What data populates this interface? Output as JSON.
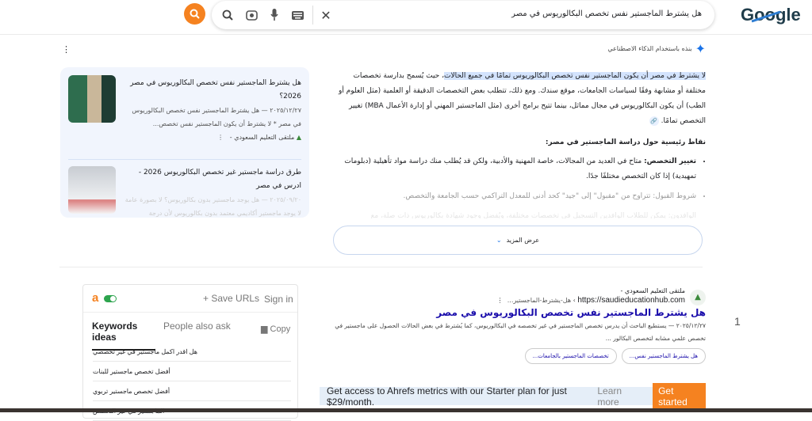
{
  "header": {
    "logo": "Google",
    "query": "هل يشترط الماجستير نفس تخصص البكالوريوس في مصر"
  },
  "ai_overview": {
    "label": "بنذه باستخدام الذكاء الاصطناعي",
    "highlight": "لا يشترط في مصر أن يكون الماجستير نفس تخصص البكالوريوس تمامًا في جميع الحالات",
    "body": "، حيث يُسمح بدارسة تخصصات مختلفة أو مشابهة وفقًا لسياسات الجامعات، موقع سندك. ومع ذلك، تتطلب بعض التخصصات الدقيقة أو العلمية (مثل العلوم أو الطب) أن يكون البكالوريوس في مجال مماثل، بينما تتيح برامج أخرى (مثل الماجستير المهني أو إدارة الأعمال MBA) تغيير التخصص تمامًا.",
    "heading": "نقاط رئيسية حول دراسة الماجستير في مصر:",
    "bullets": [
      {
        "title": "تغيير التخصص:",
        "text": " متاح في العديد من المجالات، خاصة المهنية والأدبية، ولكن قد يُطلب منك دراسة مواد تأهيلية (دبلومات تمهيدية) إذا كان التخصص مختلفًا جدًا."
      },
      {
        "title": "شروط القبول:",
        "text": " تتراوح من \"مقبول\" إلى \"جيد\" كحد أدنى للمعدل التراكمي حسب الجامعة والتخصص."
      },
      {
        "title": "الوافدون:",
        "text": " يمكن للطلاب الوافدين التسجيل في تخصصات مختلفة، ويُفضل وجود شهادة بكالوريوس ذات صلة، مع"
      }
    ],
    "show_more": "عرض المزيد"
  },
  "side_cards": [
    {
      "title": "هل يشترط الماجستير نفس تخصص البكالوريوس في مصر 2026؟",
      "snippet": "٢٠٢٥/١٢/٢٧ — هل يشترط الماجستير نفس تخصص البكالوريوس في مصر * لا يشترط أن يكون الماجستير نفس تخصص...",
      "source": "ملتقى التعليم السعودي -"
    },
    {
      "title": "طرق دراسة ماجستير غير تخصص البكالوريوس 2026 - ادرس في مصر",
      "snippet": "٢٠٢٥/٠٩/٢٠ — هل يوجد ماجستير بدون بكالوريوس؟ لا بصورة عامة لا يوجد ماجستير أكاديمي معتمد بدون بكالوريوس لأن درجة"
    }
  ],
  "result": {
    "number": "1",
    "site_name": "ملتقى التعليم السعودي -",
    "url": "https://saudieducationhub.com",
    "path": "› هل-يشترط-الماجستير...",
    "title": "هل يشترط الماجستير نفس تخصص البكالوريوس في مصر",
    "snippet": "٢٠٢٥/١٢/٢٧ — يستطيع الباحث أن يدرس تخصص الماجستير في غير تخصصه في البكالوريوس، كما يُشترط في بعض الحالات الحصول على ماجستير في تخصص علمي مشابه لتخصص البكالور ...",
    "chips": [
      "هل يشترط الماجستير نفس...",
      "تخصصات الماجستير بالجامعات..."
    ]
  },
  "banner": {
    "text": "Get access to Ahrefs metrics with our Starter plan for just $29/month.",
    "learn_more": "Learn more",
    "cta": "Get started",
    "accent": "#f58220"
  },
  "ahrefs": {
    "save_urls": "Save URLs",
    "sign_in": "Sign in",
    "tabs": [
      "Keywords ideas",
      "People also ask"
    ],
    "copy": "Copy",
    "keywords": [
      "هل اقدر اكمل ماجستير في غير تخصصي",
      "أفضل تخصص ماجستير للبنات",
      "أفضل تخصص ماجستير تربوي",
      "الماجستير في غير التخصص"
    ]
  }
}
